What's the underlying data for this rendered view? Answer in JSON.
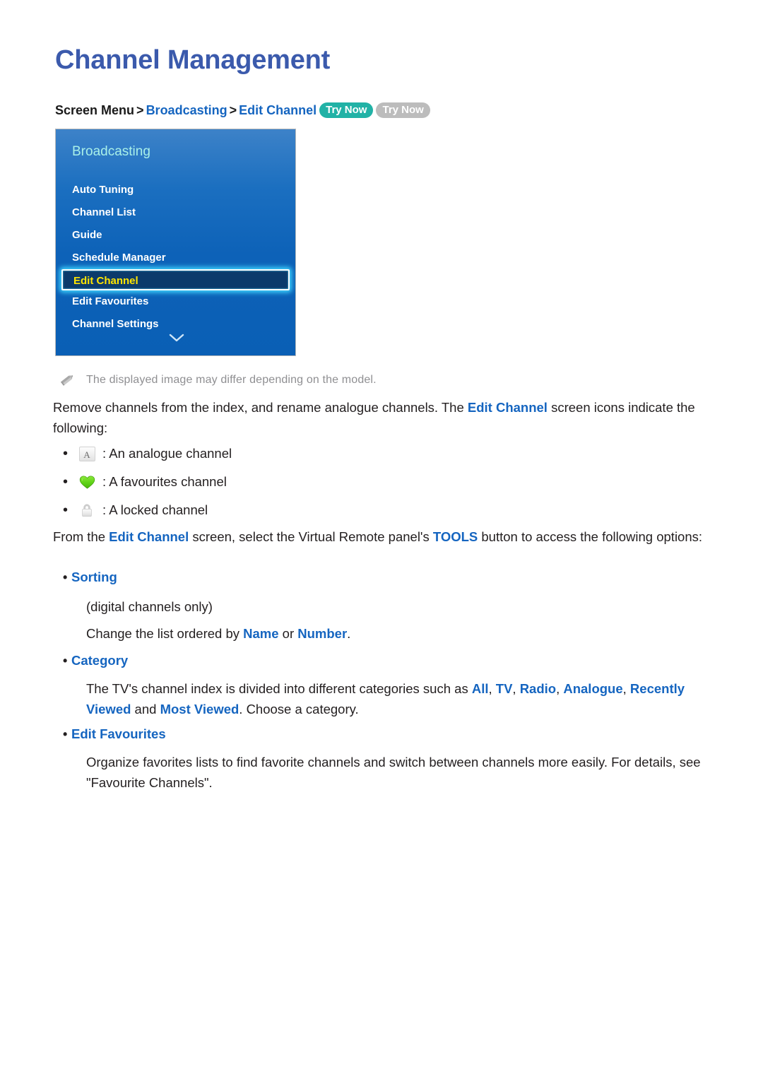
{
  "page": {
    "title": "Channel Management"
  },
  "breadcrumb": {
    "root": "Screen Menu",
    "sep": ">",
    "level1": "Broadcasting",
    "level2": "Edit Channel",
    "badge_primary": "Try Now",
    "badge_secondary": "Try Now"
  },
  "tv_menu": {
    "header": "Broadcasting",
    "items": [
      {
        "label": "Auto Tuning",
        "selected": false
      },
      {
        "label": "Channel List",
        "selected": false
      },
      {
        "label": "Guide",
        "selected": false
      },
      {
        "label": "Schedule Manager",
        "selected": false
      },
      {
        "label": "Edit Channel",
        "selected": true
      },
      {
        "label": "Edit Favourites",
        "selected": false
      },
      {
        "label": "Channel Settings",
        "selected": false
      }
    ],
    "more_icon": "chevron-down-icon",
    "colors": {
      "panel_top": "#3d82c8",
      "panel_bottom": "#0a5fb5",
      "header_text": "#a9f0e8",
      "selected_text": "#ffe500",
      "selected_fill": "#0c3a6b",
      "selected_glow": "#3fd5ff"
    }
  },
  "note": {
    "icon": "pencil-icon",
    "text": "The displayed image may differ depending on the model."
  },
  "intro": {
    "part1": "Remove channels from the index, and rename analogue channels. The ",
    "link1": "Edit Channel",
    "part2": " screen icons indicate the following:"
  },
  "legend": {
    "bullet": "•",
    "rows": [
      {
        "icon": "analogue-channel-icon",
        "icon_text": "A",
        "label": ": An analogue channel"
      },
      {
        "icon": "favourite-heart-icon",
        "icon_text": "",
        "label": ": A favourites channel"
      },
      {
        "icon": "locked-padlock-icon",
        "icon_text": "",
        "label": ": A locked channel"
      }
    ]
  },
  "tools_para": {
    "part1": "From the ",
    "link1": "Edit Channel",
    "part2": " screen, select the Virtual Remote panel's ",
    "link2": "TOOLS",
    "part3": " button to access the following options:"
  },
  "options": {
    "sorting": {
      "bullet": "•",
      "title": "Sorting",
      "note": "(digital channels only)",
      "desc_part1": "Change the list ordered by ",
      "desc_link1": "Name",
      "desc_part2": " or ",
      "desc_link2": "Number",
      "desc_part3": "."
    },
    "category": {
      "bullet": "•",
      "title": "Category",
      "desc_part1": "The TV's channel index is divided into different categories such as ",
      "desc_link1": "All",
      "desc_sep1": ", ",
      "desc_link2": "TV",
      "desc_sep2": ", ",
      "desc_link3": "Radio",
      "desc_sep3": ", ",
      "desc_link4": "Analogue",
      "desc_sep4": ", ",
      "desc_link5": "Recently Viewed",
      "desc_part2": " and ",
      "desc_link6": "Most Viewed",
      "desc_part3": ". Choose a category."
    },
    "edit_favourites": {
      "bullet": "•",
      "title": "Edit Favourites",
      "desc": "Organize favorites lists to find favorite channels and switch between channels more easily. For details, see \"Favourite Channels\"."
    }
  },
  "colors": {
    "title_blue": "#3b5aac",
    "link_blue": "#1565c0",
    "body_black": "#231f20",
    "note_gray": "#8f8f92",
    "badge_teal": "#21b2a6",
    "badge_gray": "#bcbcbc",
    "heart_green": "#5ed216"
  }
}
